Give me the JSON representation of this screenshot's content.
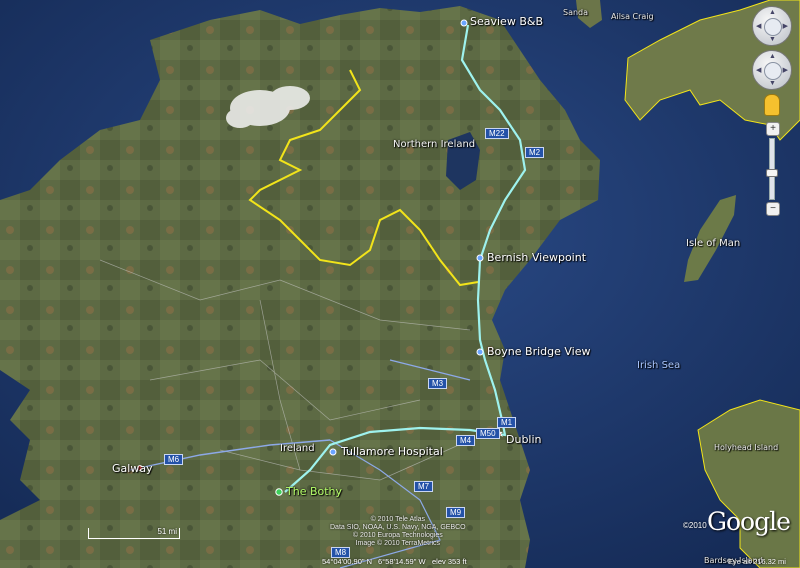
{
  "places": {
    "seaview": "Seaview B&B",
    "sanda": "Sanda",
    "ailsa_craig": "Ailsa Craig",
    "northern_ireland": "Northern Ireland",
    "bernish": "Bernish Viewpoint",
    "isle_of_man": "Isle of Man",
    "boyne": "Boyne Bridge View",
    "irish_sea": "Irish Sea",
    "dublin": "Dublin",
    "tullamore": "Tullamore Hospital",
    "ireland": "Ireland",
    "galway": "Galway",
    "bothy": "The Bothy",
    "holyhead": "Holyhead Island",
    "bardsey": "Bardsey Island"
  },
  "roads": {
    "m22": "M22",
    "m2": "M2",
    "m1": "M1",
    "m3": "M3",
    "m50": "M50",
    "m4": "M4",
    "m6": "M6",
    "m7": "M7",
    "m9": "M9",
    "m8": "M8"
  },
  "credits": {
    "line1": "© 2010 Tele Atlas",
    "line2": "Data SIO, NOAA, U.S. Navy, NGA, GEBCO",
    "line3": "© 2010 Europa Technologies",
    "line4": "Image © 2010 TerraMetrics"
  },
  "status": {
    "coords": "54°04'00.90\" N",
    "lon": "6°58'14.59\" W",
    "elev": "elev   353 ft",
    "eye": "Eye alt   216.32 mi"
  },
  "brand": {
    "google": "Google",
    "copyright": "©2010"
  },
  "scale": {
    "label": "51 mi"
  },
  "nav": {
    "look_icon": "eye-icon",
    "move_icon": "pan-icon",
    "zoom_in": "+",
    "zoom_out": "−"
  },
  "colors": {
    "route": "#9ef2ee",
    "border": "#f2e41a",
    "water": "#1b3566",
    "land": "#5b6b42"
  }
}
